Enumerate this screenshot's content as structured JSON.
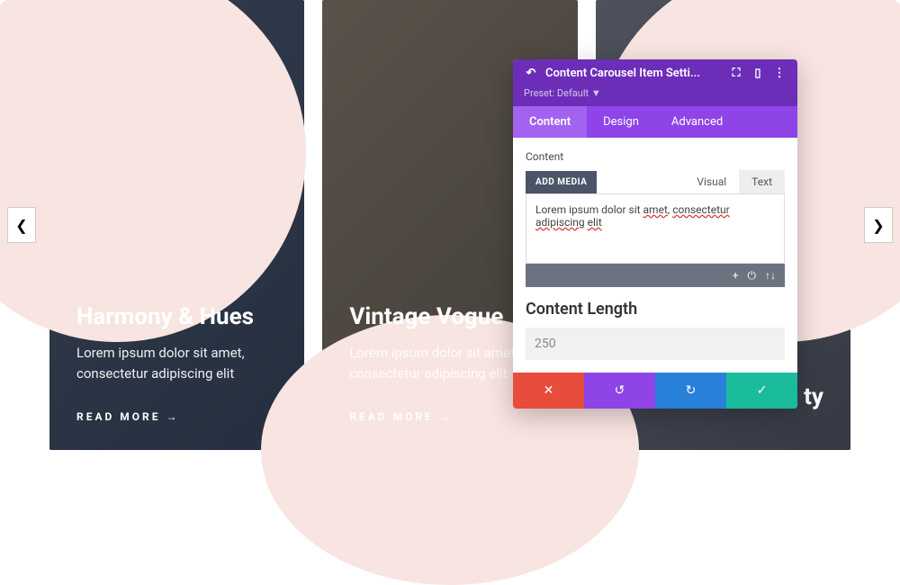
{
  "cards": [
    {
      "title": "Harmony & Hues",
      "desc": "Lorem ipsum dolor sit amet, consectetur adipiscing elit",
      "cta": "READ MORE"
    },
    {
      "title": "Vintage Vogue",
      "desc": "Lorem ipsum dolor sit amet, consectetur adipiscing elit",
      "cta": "READ MORE"
    },
    {
      "title": "ty",
      "desc": "",
      "cta": ""
    }
  ],
  "panel": {
    "title": "Content Carousel Item Setti...",
    "preset": "Preset: Default",
    "tabs": {
      "content": "Content",
      "design": "Design",
      "advanced": "Advanced"
    },
    "contentLabel": "Content",
    "addMedia": "ADD MEDIA",
    "subtabs": {
      "visual": "Visual",
      "text": "Text"
    },
    "editorText": "Lorem ipsum dolor sit amet, consectetur adipiscing elit",
    "lengthLabel": "Content Length",
    "lengthValue": "250"
  }
}
